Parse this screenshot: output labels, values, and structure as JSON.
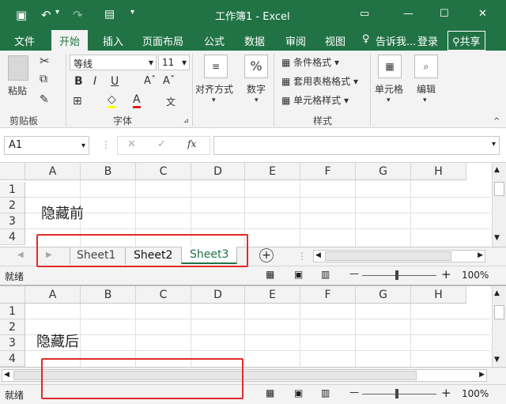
{
  "window": {
    "title": "工作簿1 - Excel",
    "share": "共享",
    "signin": "登录",
    "tell": "告诉我..."
  },
  "tabs": [
    "文件",
    "开始",
    "插入",
    "页面布局",
    "公式",
    "数据",
    "审阅",
    "视图"
  ],
  "ribbon": {
    "paste": "粘贴",
    "clipboard": "剪贴板",
    "font_name": "等线",
    "font_size": "11",
    "font_group": "字体",
    "bold": "B",
    "italic": "I",
    "underline": "U",
    "align": "对齐方式",
    "number": "数字",
    "percent": "%",
    "cond": "条件格式",
    "table": "套用表格格式",
    "cellstyle": "单元格样式",
    "styles": "样式",
    "cells": "单元格",
    "edit": "编辑"
  },
  "formula": {
    "namebox": "A1",
    "fx": "fx"
  },
  "columns": [
    "A",
    "B",
    "C",
    "D",
    "E",
    "F",
    "G",
    "H"
  ],
  "rows": [
    "1",
    "2",
    "3",
    "4"
  ],
  "top": {
    "text": "隐藏前",
    "sheets": [
      "Sheet1",
      "Sheet2",
      "Sheet3"
    ]
  },
  "bottom": {
    "text": "隐藏后"
  },
  "status": {
    "ready": "就绪",
    "zoom": "100%"
  }
}
